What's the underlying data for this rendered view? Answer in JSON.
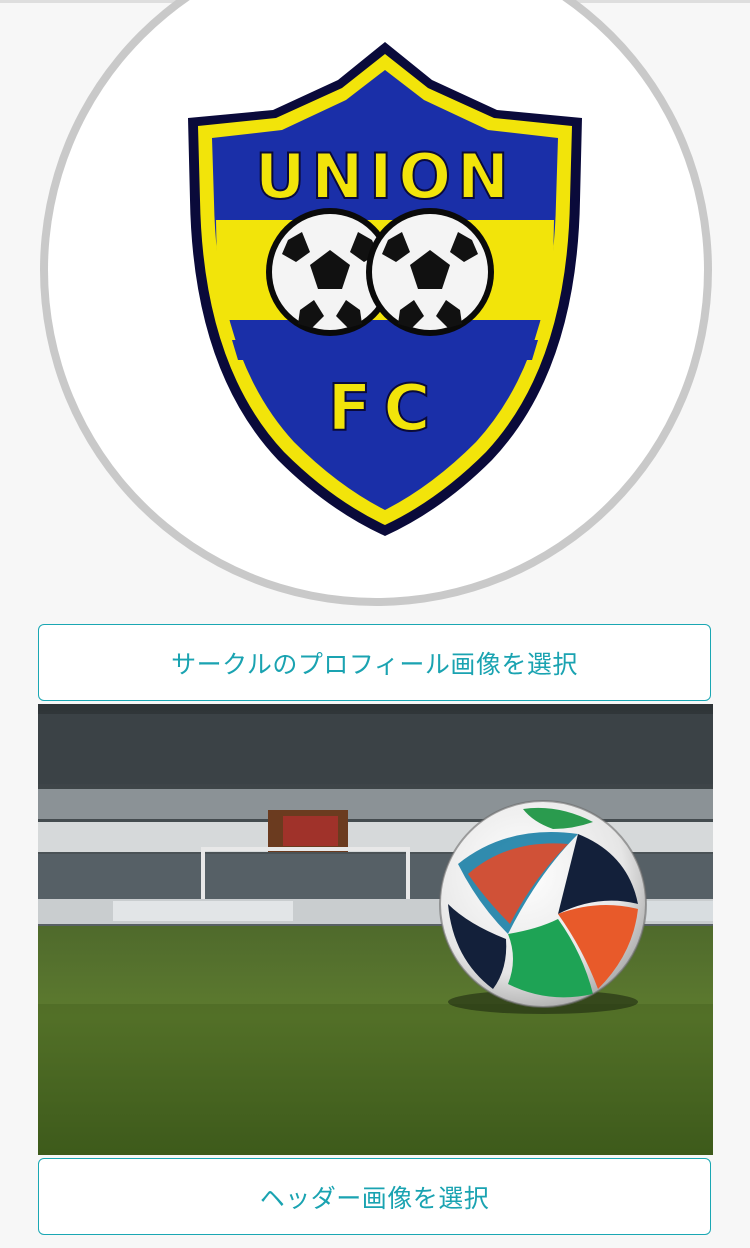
{
  "profile": {
    "crest_lettering_top": "UNION",
    "crest_lettering_bottom": "FC",
    "crest_colors": {
      "blue": "#1a2fa8",
      "yellow": "#f2e40a",
      "outline": "#0a0a3a"
    },
    "select_button_label": "サークルのプロフィール画像を選択"
  },
  "header": {
    "image_subject": "soccer ball on grass in stadium",
    "select_button_label": "ヘッダー画像を選択"
  },
  "colors": {
    "accent": "#1aa7b3",
    "background": "#f7f7f7",
    "avatar_ring": "#c9c9c9"
  }
}
